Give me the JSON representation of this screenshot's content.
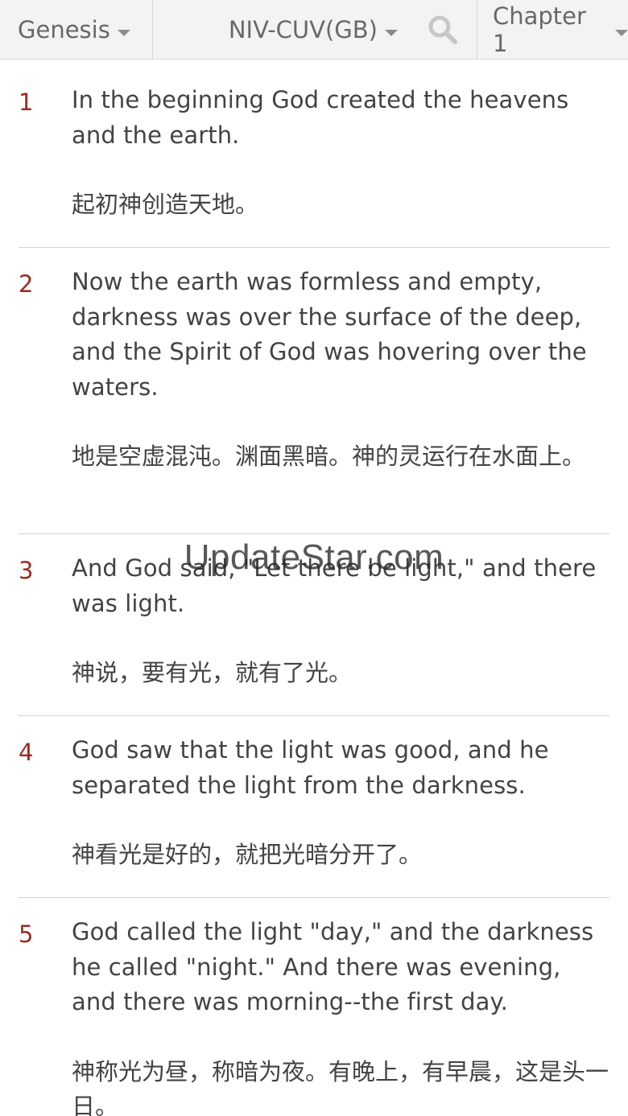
{
  "toolbar": {
    "book": "Genesis",
    "version": "NIV-CUV(GB)",
    "chapter": "Chapter 1",
    "search_icon": "search-icon"
  },
  "verses": [
    {
      "number": "1",
      "en": "In the beginning God created the heavens and the earth.",
      "zh": "起初神创造天地。"
    },
    {
      "number": "2",
      "en": "Now the earth was formless and empty, darkness was over the surface of the deep, and the Spirit of God was hovering over the waters.",
      "zh": "地是空虚混沌。渊面黑暗。神的灵运行在水面上。"
    },
    {
      "number": "3",
      "en": "And God said, \"Let there be light,\" and there was light.",
      "zh": "神说，要有光，就有了光。"
    },
    {
      "number": "4",
      "en": "God saw that the light was good, and he separated the light from the darkness.",
      "zh": "神看光是好的，就把光暗分开了。"
    },
    {
      "number": "5",
      "en": "God called the light \"day,\" and the darkness he called \"night.\" And there was evening, and there was morning--the first day.",
      "zh": "神称光为昼，称暗为夜。有晚上，有早晨，这是头一日。"
    }
  ],
  "watermark": "UpdateStar.com",
  "colors": {
    "verse_number": "#9b2a22",
    "toolbar_bg": "#f4f3f1",
    "divider": "#d5d3d0"
  }
}
